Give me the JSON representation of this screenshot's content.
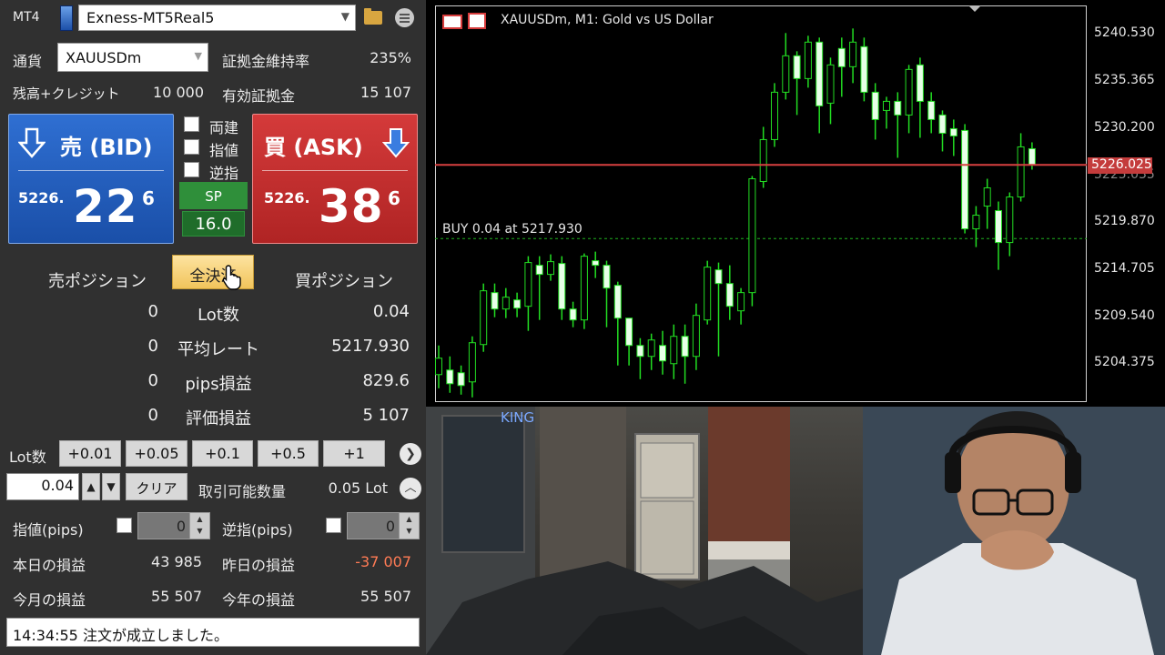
{
  "app": {
    "name": "MT4",
    "account": "Exness-MT5Real5"
  },
  "info": {
    "symbol_label": "通貨",
    "symbol": "XAUUSDm",
    "margin_level_label": "証拠金維持率",
    "margin_level": "235%",
    "balance_label": "残高+クレジット",
    "balance": "10 000",
    "equity_label": "有効証拠金",
    "equity": "15 107"
  },
  "bid": {
    "title": "売 (BID)",
    "price_prefix": "5226.",
    "price_main": "22",
    "price_sup": "6"
  },
  "ask": {
    "title": "買 (ASK)",
    "price_prefix": "5226.",
    "price_main": "38",
    "price_sup": "6"
  },
  "options": {
    "hedge": "両建",
    "limit": "指値",
    "stop": "逆指"
  },
  "spread": {
    "label": "SP",
    "value": "16.0"
  },
  "positions": {
    "sell_header": "売ポジション",
    "close_all": "全決済",
    "buy_header": "買ポジション",
    "rows": [
      {
        "sell": "0",
        "label": "Lot数",
        "buy": "0.04"
      },
      {
        "sell": "0",
        "label": "平均レート",
        "buy": "5217.930"
      },
      {
        "sell": "0",
        "label": "pips損益",
        "buy": "829.6"
      },
      {
        "sell": "0",
        "label": "評価損益",
        "buy": "5 107"
      }
    ]
  },
  "lot": {
    "label": "Lot数",
    "steps": [
      "+0.01",
      "+0.05",
      "+0.1",
      "+0.5",
      "+1"
    ],
    "value": "0.04",
    "clear": "クリア",
    "tradable_label": "取引可能数量",
    "tradable": "0.05 Lot"
  },
  "pips": {
    "limit_label": "指値(pips)",
    "limit_value": "0",
    "stop_label": "逆指(pips)",
    "stop_value": "0"
  },
  "pnl": {
    "today_label": "本日の損益",
    "today": "43 985",
    "yesterday_label": "昨日の損益",
    "yesterday": "-37 007",
    "month_label": "今月の損益",
    "month": "55 507",
    "year_label": "今年の損益",
    "year": "55 507"
  },
  "status": "14:34:55 注文が成立しました。",
  "chart": {
    "title": "XAUUSDm, M1:  Gold vs US Dollar",
    "order_line": "BUY 0.04 at 5217.930",
    "current_price": "5226.025",
    "hidden_tick": "5225.035",
    "ticks": [
      "5240.530",
      "5235.365",
      "5230.200",
      "5219.870",
      "5214.705",
      "5209.540",
      "5204.375"
    ],
    "bull_color": "#22dd22",
    "line_color": "#d84040",
    "scene_sign": "KING"
  },
  "chart_data": {
    "type": "candlestick",
    "title": "XAUUSDm, M1:  Gold vs US Dollar",
    "ylim": [
      5200.5,
      5243.0
    ],
    "y_ticks": [
      5204.375,
      5209.54,
      5214.705,
      5219.87,
      5225.035,
      5230.2,
      5235.365,
      5240.53
    ],
    "horizontal_lines": [
      {
        "name": "BUY 0.04 at 5217.930",
        "y": 5217.93,
        "style": "dashed"
      },
      {
        "name": "5226.025",
        "y": 5226.025,
        "style": "solid"
      }
    ],
    "candles": [
      [
        5203.0,
        5204.8,
        5201.5,
        5206.2
      ],
      [
        5203.5,
        5202.0,
        5201.0,
        5205.0
      ],
      [
        5203.2,
        5201.8,
        5200.8,
        5204.0
      ],
      [
        5202.2,
        5206.5,
        5200.5,
        5207.2
      ],
      [
        5206.3,
        5212.2,
        5205.5,
        5213.0
      ],
      [
        5212.0,
        5210.2,
        5209.3,
        5213.0
      ],
      [
        5210.2,
        5211.5,
        5209.2,
        5212.5
      ],
      [
        5211.2,
        5210.3,
        5209.3,
        5212.0
      ],
      [
        5210.5,
        5215.3,
        5207.8,
        5216.0
      ],
      [
        5215.0,
        5214.0,
        5209.0,
        5216.0
      ],
      [
        5214.0,
        5215.4,
        5213.3,
        5216.2
      ],
      [
        5215.2,
        5210.2,
        5209.0,
        5216.0
      ],
      [
        5210.2,
        5209.0,
        5208.2,
        5211.0
      ],
      [
        5209.0,
        5216.0,
        5208.0,
        5216.3
      ],
      [
        5215.5,
        5215.0,
        5213.6,
        5216.5
      ],
      [
        5215.0,
        5212.5,
        5208.2,
        5215.5
      ],
      [
        5212.8,
        5209.2,
        5204.0,
        5213.2
      ],
      [
        5209.2,
        5206.2,
        5204.0,
        5208.5
      ],
      [
        5206.2,
        5205.0,
        5202.5,
        5207.0
      ],
      [
        5205.0,
        5206.8,
        5203.5,
        5207.5
      ],
      [
        5206.2,
        5204.5,
        5203.0,
        5207.8
      ],
      [
        5204.2,
        5207.2,
        5202.5,
        5208.5
      ],
      [
        5207.2,
        5205.0,
        5202.0,
        5208.5
      ],
      [
        5205.0,
        5209.5,
        5203.5,
        5210.8
      ],
      [
        5209.0,
        5214.8,
        5208.5,
        5215.5
      ],
      [
        5214.5,
        5213.0,
        5205.0,
        5215.3
      ],
      [
        5213.0,
        5210.5,
        5209.0,
        5215.0
      ],
      [
        5210.0,
        5212.0,
        5208.5,
        5212.5
      ],
      [
        5212.0,
        5224.5,
        5210.5,
        5224.8
      ],
      [
        5224.2,
        5228.8,
        5223.5,
        5230.2
      ],
      [
        5228.8,
        5234.0,
        5228.0,
        5235.0
      ],
      [
        5234.0,
        5238.0,
        5233.2,
        5240.5
      ],
      [
        5238.0,
        5235.5,
        5231.5,
        5238.5
      ],
      [
        5235.5,
        5239.5,
        5234.5,
        5240.2
      ],
      [
        5239.5,
        5232.5,
        5229.5,
        5240.0
      ],
      [
        5232.8,
        5237.0,
        5230.5,
        5237.8
      ],
      [
        5238.8,
        5236.8,
        5233.5,
        5240.0
      ],
      [
        5236.8,
        5239.5,
        5235.0,
        5241.0
      ],
      [
        5239.0,
        5234.0,
        5233.0,
        5240.0
      ],
      [
        5234.0,
        5231.0,
        5228.8,
        5235.0
      ],
      [
        5232.0,
        5233.0,
        5230.0,
        5233.5
      ],
      [
        5233.0,
        5231.5,
        5226.8,
        5234.0
      ],
      [
        5231.5,
        5236.5,
        5229.5,
        5237.0
      ],
      [
        5237.0,
        5233.0,
        5229.0,
        5237.8
      ],
      [
        5233.0,
        5231.0,
        5229.5,
        5234.0
      ],
      [
        5231.5,
        5229.5,
        5227.5,
        5232.0
      ],
      [
        5230.0,
        5229.2,
        5227.0,
        5231.0
      ],
      [
        5229.8,
        5219.0,
        5218.5,
        5230.5
      ],
      [
        5219.0,
        5220.5,
        5217.0,
        5221.5
      ],
      [
        5221.5,
        5223.5,
        5219.0,
        5224.5
      ],
      [
        5221.0,
        5217.5,
        5214.5,
        5222.0
      ],
      [
        5217.5,
        5222.5,
        5216.0,
        5223.0
      ],
      [
        5222.5,
        5228.0,
        5222.0,
        5229.5
      ],
      [
        5227.8,
        5226.0,
        5225.5,
        5228.5
      ]
    ]
  }
}
